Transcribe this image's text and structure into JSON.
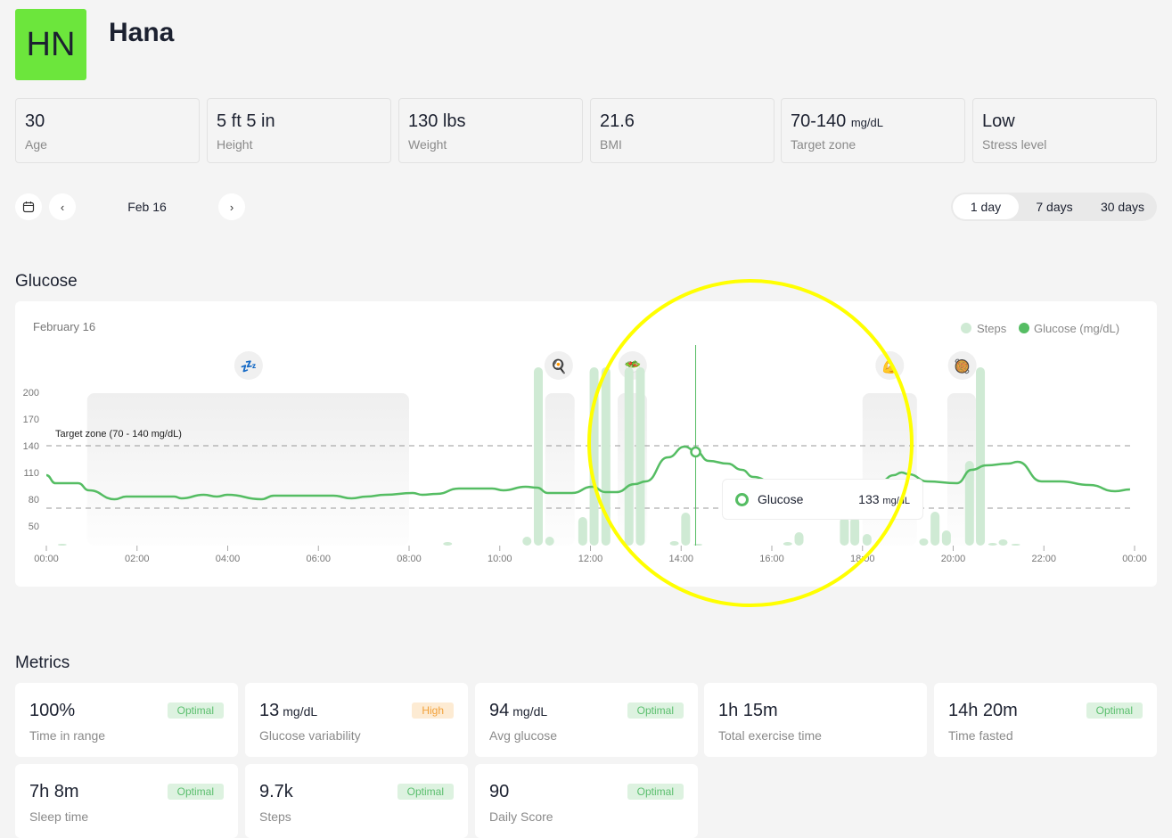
{
  "profile": {
    "initials": "HN",
    "name": "Hana",
    "avatar_color": "#6ce63c"
  },
  "stats": [
    {
      "value": "30",
      "unit": "",
      "label": "Age"
    },
    {
      "value": "5 ft 5 in",
      "unit": "",
      "label": "Height"
    },
    {
      "value": "130 lbs",
      "unit": "",
      "label": "Weight"
    },
    {
      "value": "21.6",
      "unit": "",
      "label": "BMI"
    },
    {
      "value": "70-140",
      "unit": "mg/dL",
      "label": "Target zone"
    },
    {
      "value": "Low",
      "unit": "",
      "label": "Stress level"
    }
  ],
  "date_nav": {
    "calendar_icon": "calendar-icon",
    "prev": "‹",
    "date": "Feb 16",
    "next": "›"
  },
  "range_tabs": [
    {
      "label": "1 day",
      "active": true
    },
    {
      "label": "7 days",
      "active": false
    },
    {
      "label": "30 days",
      "active": false
    }
  ],
  "glucose_section": {
    "title": "Glucose"
  },
  "chart_data": {
    "type": "line",
    "date_label": "February 16",
    "legend": [
      {
        "name": "Steps",
        "color": "#cfead4"
      },
      {
        "name": "Glucose (mg/dL)",
        "color": "#55bd63"
      }
    ],
    "legend_position": "top-right",
    "y_ticks": [
      200,
      170,
      140,
      110,
      80,
      50
    ],
    "ylim": [
      30,
      200
    ],
    "x_ticks": [
      "00:00",
      "02:00",
      "04:00",
      "06:00",
      "08:00",
      "10:00",
      "12:00",
      "14:00",
      "16:00",
      "18:00",
      "20:00",
      "22:00",
      "00:00"
    ],
    "target_zone": {
      "label": "Target zone (70 - 140 mg/dL)",
      "low": 70,
      "high": 140
    },
    "glucose": {
      "t": [
        0,
        0.2,
        0.7,
        0.94,
        1.51,
        1.76,
        2.82,
        2.98,
        3.47,
        3.76,
        4.0,
        4.74,
        5.02,
        6.33,
        6.73,
        7.06,
        7.47,
        8.08,
        8.29,
        8.61,
        9.1,
        9.83,
        10.08,
        10.57,
        10.82,
        11.06,
        11.59,
        12.04,
        12.33,
        12.57,
        12.98,
        13.22,
        13.71,
        14.08,
        14.32,
        14.61,
        15.02,
        15.34,
        15.59,
        16.2,
        17.0,
        17.8,
        18.4,
        18.69,
        18.86,
        19.02,
        19.43,
        20.08,
        20.41,
        20.73,
        21.22,
        21.42,
        21.95,
        22.36,
        23.0,
        23.57,
        23.9
      ],
      "v": [
        107,
        98,
        98,
        90,
        80,
        83,
        83,
        81,
        85,
        83,
        85,
        80,
        84,
        84,
        81,
        83,
        85,
        87,
        85,
        86,
        92,
        92,
        90,
        94,
        93,
        87,
        87,
        94,
        88,
        88,
        97,
        100,
        127,
        139,
        134,
        123,
        120,
        113,
        105,
        92,
        90,
        92,
        100,
        107,
        110,
        108,
        100,
        98,
        113,
        118,
        120,
        122,
        100,
        100,
        96,
        89,
        91
      ]
    },
    "steps": {
      "t": [
        0.35,
        8.85,
        10.6,
        10.85,
        11.1,
        11.83,
        12.08,
        12.34,
        12.85,
        13.1,
        13.85,
        14.1,
        14.37,
        16.35,
        16.6,
        17.6,
        17.83,
        18.1,
        19.35,
        19.6,
        19.85,
        20.36,
        20.6,
        20.87,
        21.1,
        21.38
      ],
      "v": [
        2,
        4,
        10,
        200,
        10,
        32,
        200,
        200,
        200,
        200,
        5,
        37,
        1,
        4,
        15,
        32,
        32,
        13,
        8,
        38,
        17,
        95,
        200,
        3,
        7,
        1
      ]
    },
    "events": [
      {
        "icon": "sleep-icon",
        "glyph": "💤",
        "start": 0.9,
        "end": 8.0,
        "at": 4.46
      },
      {
        "icon": "breakfast-icon",
        "glyph": "🍳",
        "start": 11.0,
        "end": 11.65,
        "at": 11.3
      },
      {
        "icon": "salad-icon",
        "glyph": "🥗",
        "start": 12.6,
        "end": 13.25,
        "at": 12.93
      },
      {
        "icon": "exercise-icon",
        "glyph": "💪",
        "start": 18.0,
        "end": 19.2,
        "at": 18.6
      },
      {
        "icon": "dinner-icon",
        "glyph": "🥘",
        "start": 19.87,
        "end": 20.5,
        "at": 20.2
      }
    ],
    "cursor": {
      "t": 14.32,
      "v": 133
    },
    "tooltip": {
      "label": "Glucose",
      "value": "133",
      "unit": "mg/dL"
    }
  },
  "metrics_section": {
    "title": "Metrics"
  },
  "metrics": [
    {
      "value": "100%",
      "unit": "",
      "label": "Time in range",
      "badge": "Optimal",
      "status": "optimal"
    },
    {
      "value": "13",
      "unit": "mg/dL",
      "label": "Glucose variability",
      "badge": "High",
      "status": "high"
    },
    {
      "value": "94",
      "unit": "mg/dL",
      "label": "Avg glucose",
      "badge": "Optimal",
      "status": "optimal"
    },
    {
      "value": "1h 15m",
      "unit": "",
      "label": "Total exercise time",
      "badge": "",
      "status": ""
    },
    {
      "value": "14h 20m",
      "unit": "",
      "label": "Time fasted",
      "badge": "Optimal",
      "status": "optimal"
    },
    {
      "value": "7h 8m",
      "unit": "",
      "label": "Sleep time",
      "badge": "Optimal",
      "status": "optimal"
    },
    {
      "value": "9.7k",
      "unit": "",
      "label": "Steps",
      "badge": "Optimal",
      "status": "optimal"
    },
    {
      "value": "90",
      "unit": "",
      "label": "Daily Score",
      "badge": "Optimal",
      "status": "optimal"
    }
  ],
  "colors": {
    "glucose": "#55bd63",
    "steps": "#cfead4",
    "highlight": "#ffff00"
  }
}
